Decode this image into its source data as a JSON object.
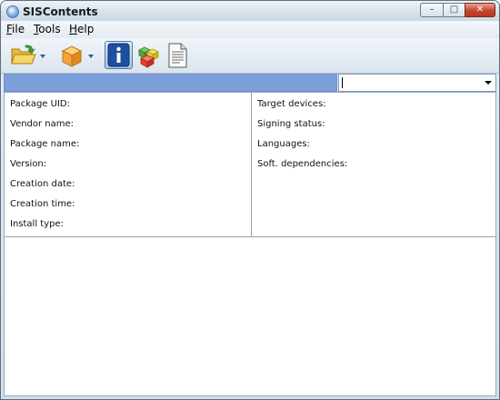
{
  "window": {
    "title": "SISContents",
    "controls": {
      "minimize": "–",
      "maximize": "□",
      "close": "✕"
    }
  },
  "menu": [
    {
      "key": "F",
      "rest": "ile"
    },
    {
      "key": "T",
      "rest": "ools"
    },
    {
      "key": "H",
      "rest": "elp"
    }
  ],
  "toolbar": {
    "icons": [
      "open-folder-icon",
      "package-icon",
      "info-icon",
      "components-icon",
      "document-icon"
    ]
  },
  "combo": {
    "value": ""
  },
  "package_info": {
    "left": [
      "Package UID:",
      "Vendor name:",
      "Package name:",
      "Version:",
      "Creation date:",
      "Creation time:",
      "Install type:"
    ],
    "right": [
      "Target devices:",
      "Signing status:",
      "Languages:",
      "Soft. dependencies:"
    ]
  },
  "colors": {
    "progress": "#7b9fdb",
    "close_button": "#c8452a"
  }
}
